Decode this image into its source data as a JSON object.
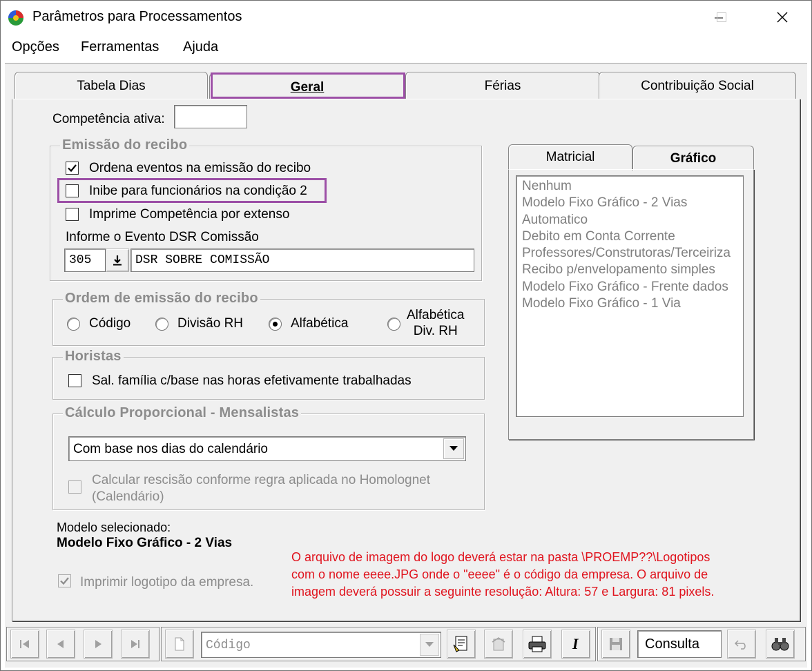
{
  "window": {
    "title": "Parâmetros para Processamentos"
  },
  "menu": {
    "items": [
      "Opções",
      "Ferramentas",
      "Ajuda"
    ]
  },
  "tabs": [
    "Tabela Dias",
    "Geral",
    "Férias",
    "Contribuição Social"
  ],
  "competencia": {
    "label": "Competência ativa:",
    "value": ""
  },
  "emissao": {
    "title": "Emissão do recibo",
    "ordena": {
      "label": "Ordena eventos na emissão do recibo",
      "checked": true
    },
    "inibe": {
      "label": "Inibe para funcionários na condição 2",
      "checked": false
    },
    "imprime": {
      "label": "Imprime Competência por extenso",
      "checked": false
    },
    "dsr_label": "Informe o Evento DSR Comissão",
    "dsr_code": "305",
    "dsr_desc": "DSR SOBRE COMISSÃO"
  },
  "ordem": {
    "title": "Ordem de emissão do recibo",
    "options": [
      "Código",
      "Divisão RH",
      "Alfabética"
    ],
    "option4_line1": "Alfabética",
    "option4_line2": "Div.  RH",
    "selected": "Alfabética"
  },
  "horistas": {
    "title": "Horistas",
    "sal_familia": {
      "label": "Sal. família c/base nas horas efetivamente trabalhadas",
      "checked": false
    }
  },
  "calculo": {
    "title": "Cálculo Proporcional - Mensalistas",
    "select_value": "Com base nos dias do calendário",
    "rescisao_line1": "Calcular rescisão conforme regra aplicada no Homolognet",
    "rescisao_line2": "(Calendário)"
  },
  "modelo": {
    "label": "Modelo selecionado:",
    "value": "Modelo Fixo Gráfico - 2 Vias"
  },
  "logotipo": {
    "label": "Imprimir logotipo da empresa.",
    "checked": true
  },
  "note": {
    "line1": "O arquivo de imagem do logo deverá estar na pasta \\PROEMP??\\Logotipos",
    "line2": "com o nome eeee.JPG onde o \"eeee\" é o código da empresa. O arquivo de",
    "line3": "imagem deverá possuir a seguinte resolução: Altura: 57 e Largura: 81 pixels."
  },
  "subtabs": [
    "Matricial",
    "Gráfico"
  ],
  "models": [
    "Nenhum",
    "Modelo Fixo Gráfico - 2 Vias",
    "Automatico",
    "Debito em Conta Corrente",
    "Professores/Construtoras/Terceiriza",
    "Recibo p/envelopamento simples",
    "Modelo Fixo Gráfico - Frente dados",
    "Modelo Fixo Gráfico - 1 Via"
  ],
  "toolbar": {
    "search_placeholder": "Código",
    "mode": "Consulta"
  },
  "colors": {
    "highlight": "#9c4fa6",
    "note": "#e0141e",
    "disabled": "#8c8c8c"
  }
}
